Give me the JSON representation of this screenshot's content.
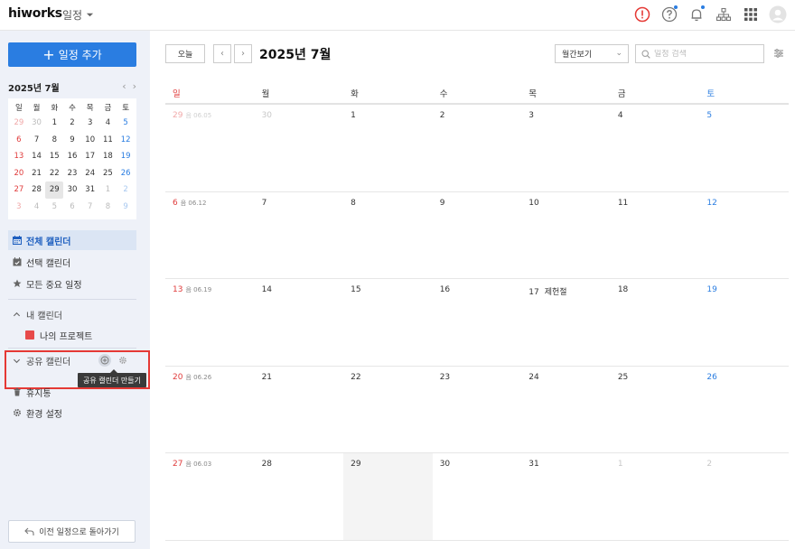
{
  "topbar": {
    "logo": "hiworks",
    "app_menu": "일정"
  },
  "sidebar": {
    "add_button": "일정 추가",
    "mini_calendar": {
      "title": "2025년 7월",
      "weekdays": [
        "일",
        "월",
        "화",
        "수",
        "목",
        "금",
        "토"
      ],
      "weeks": [
        [
          "29",
          "30",
          "1",
          "2",
          "3",
          "4",
          "5"
        ],
        [
          "6",
          "7",
          "8",
          "9",
          "10",
          "11",
          "12"
        ],
        [
          "13",
          "14",
          "15",
          "16",
          "17",
          "18",
          "19"
        ],
        [
          "20",
          "21",
          "22",
          "23",
          "24",
          "25",
          "26"
        ],
        [
          "27",
          "28",
          "29",
          "30",
          "31",
          "1",
          "2"
        ],
        [
          "3",
          "4",
          "5",
          "6",
          "7",
          "8",
          "9"
        ]
      ]
    },
    "nav": {
      "all_calendars": "전체 캘린더",
      "selected_calendars": "선택 캘린더",
      "important": "모든 중요 일정"
    },
    "my_calendars": {
      "label": "내 캘린더",
      "items": [
        {
          "label": "나의 프로젝트",
          "color": "#e74a4a"
        }
      ]
    },
    "shared_calendars": {
      "label": "공유 캘린더",
      "tooltip": "공유 캘린더 만들기"
    },
    "trash": "휴지통",
    "settings": "환경 설정",
    "back_button": "이전 일정으로 돌아가기"
  },
  "main": {
    "today_button": "오늘",
    "month_title": "2025년 7월",
    "view_select": "월간보기",
    "search_placeholder": "일정 검색",
    "weekdays": [
      "일",
      "월",
      "화",
      "수",
      "목",
      "금",
      "토"
    ],
    "weeks": [
      [
        {
          "d": "29",
          "lunar": "음 06.05"
        },
        {
          "d": "30"
        },
        {
          "d": "1"
        },
        {
          "d": "2"
        },
        {
          "d": "3"
        },
        {
          "d": "4"
        },
        {
          "d": "5"
        }
      ],
      [
        {
          "d": "6",
          "lunar": "음 06.12"
        },
        {
          "d": "7"
        },
        {
          "d": "8"
        },
        {
          "d": "9"
        },
        {
          "d": "10"
        },
        {
          "d": "11"
        },
        {
          "d": "12"
        }
      ],
      [
        {
          "d": "13",
          "lunar": "음 06.19"
        },
        {
          "d": "14"
        },
        {
          "d": "15"
        },
        {
          "d": "16"
        },
        {
          "d": "17",
          "holiday": "제헌절"
        },
        {
          "d": "18"
        },
        {
          "d": "19"
        }
      ],
      [
        {
          "d": "20",
          "lunar": "음 06.26"
        },
        {
          "d": "21"
        },
        {
          "d": "22"
        },
        {
          "d": "23"
        },
        {
          "d": "24"
        },
        {
          "d": "25"
        },
        {
          "d": "26"
        }
      ],
      [
        {
          "d": "27",
          "lunar": "음 06.03"
        },
        {
          "d": "28"
        },
        {
          "d": "29"
        },
        {
          "d": "30"
        },
        {
          "d": "31"
        },
        {
          "d": "1"
        },
        {
          "d": "2"
        }
      ]
    ]
  }
}
